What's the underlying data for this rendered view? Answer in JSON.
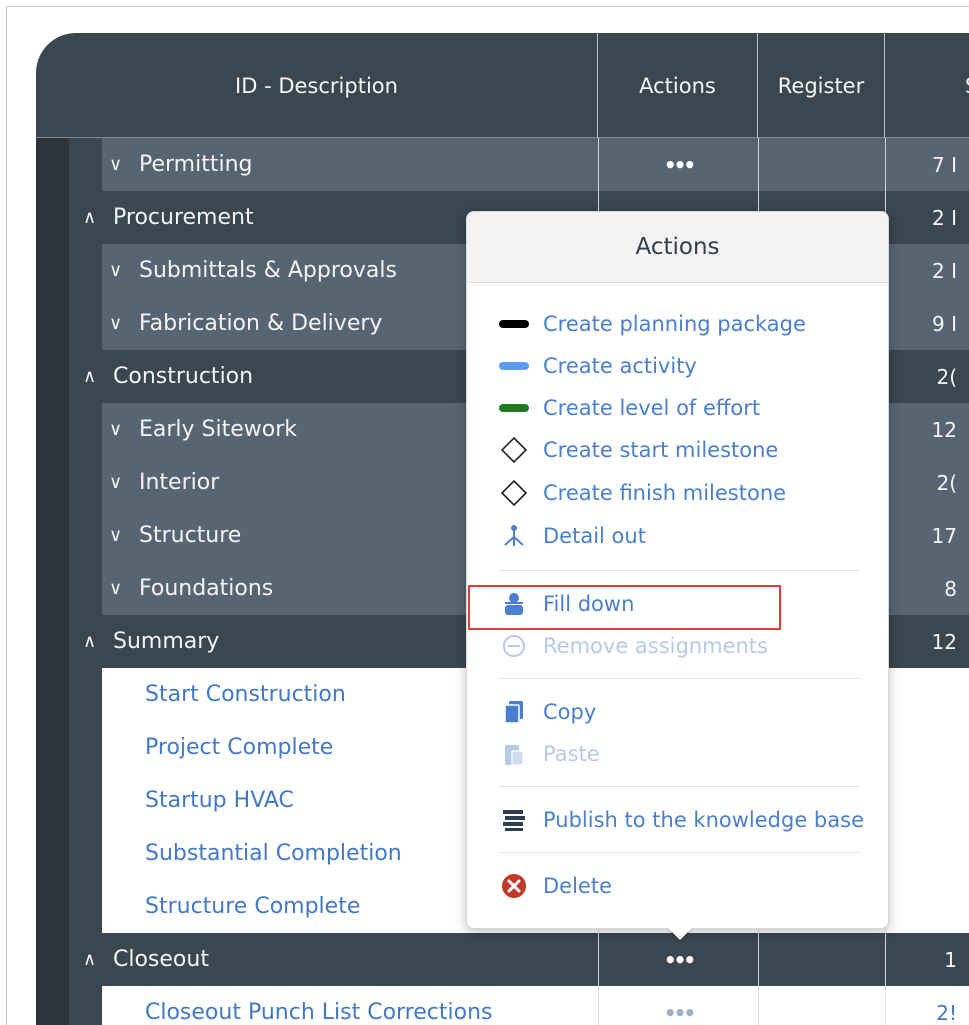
{
  "columns": {
    "desc": "ID - Description",
    "actions": "Actions",
    "register": "Register",
    "next": "S"
  },
  "rows": [
    {
      "label": "Permitting",
      "chev": "v",
      "num": "7 I",
      "dots": "•••"
    },
    {
      "label": "Procurement",
      "chev": "^",
      "num": "2 I"
    },
    {
      "label": "Submittals & Approvals",
      "chev": "v",
      "num": "2 I"
    },
    {
      "label": "Fabrication & Delivery",
      "chev": "v",
      "num": "9 I"
    },
    {
      "label": "Construction",
      "chev": "^",
      "num": "2("
    },
    {
      "label": "Early Sitework",
      "chev": "v",
      "num": "12"
    },
    {
      "label": "Interior",
      "chev": "v",
      "num": "2("
    },
    {
      "label": "Structure",
      "chev": "v",
      "num": "17"
    },
    {
      "label": "Foundations",
      "chev": "v",
      "num": "8"
    },
    {
      "label": "Summary",
      "chev": "^",
      "num": "12"
    },
    {
      "label": "Start Construction"
    },
    {
      "label": "Project Complete"
    },
    {
      "label": "Startup HVAC"
    },
    {
      "label": "Substantial Completion"
    },
    {
      "label": "Structure Complete"
    },
    {
      "label": "Closeout",
      "chev": "^",
      "num": "1",
      "dots": "•••"
    },
    {
      "label": "Closeout Punch List Corrections",
      "num": "2!",
      "dots": "•••"
    }
  ],
  "popup": {
    "title": "Actions",
    "items": [
      {
        "label": "Create planning package",
        "icon": "black-bar-icon"
      },
      {
        "label": "Create activity",
        "icon": "blue-bar-icon"
      },
      {
        "label": "Create level of effort",
        "icon": "green-bar-icon"
      },
      {
        "label": "Create start milestone",
        "icon": "diamond-icon"
      },
      {
        "label": "Create finish milestone",
        "icon": "diamond-icon"
      },
      {
        "label": "Detail out",
        "icon": "hierarchy-icon"
      },
      {
        "label": "Fill down",
        "icon": "person-fill-icon"
      },
      {
        "label": "Remove assignments",
        "icon": "remove-circle-icon"
      },
      {
        "label": "Copy",
        "icon": "copy-icon"
      },
      {
        "label": "Paste",
        "icon": "paste-icon"
      },
      {
        "label": "Publish to the knowledge base",
        "icon": "books-icon"
      },
      {
        "label": "Delete",
        "icon": "delete-icon"
      }
    ]
  },
  "colors": {
    "header": "#3a4650",
    "group": "#566571",
    "link": "#4a7fd0",
    "highlight": "#e53b3b",
    "delete": "#c0392b",
    "effort_green": "#1f7a1f",
    "activity_blue": "#5b9bf0"
  }
}
